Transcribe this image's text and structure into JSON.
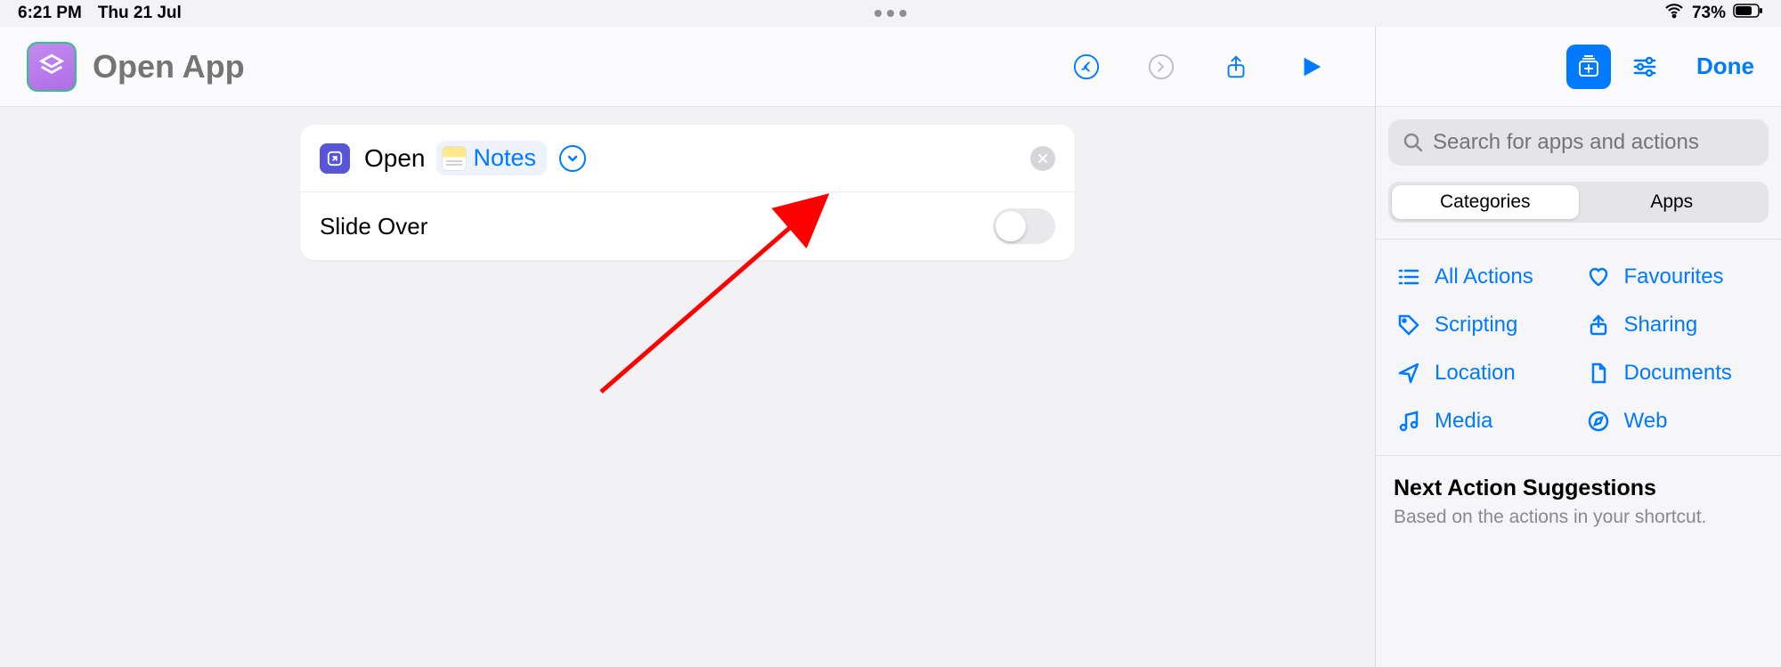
{
  "status": {
    "time": "6:21 PM",
    "date": "Thu 21 Jul",
    "battery_pct": "73%"
  },
  "header": {
    "title_placeholder": "Open App"
  },
  "action": {
    "verb": "Open",
    "app_label": "Notes",
    "slide_over_label": "Slide Over",
    "slide_over_on": false
  },
  "right": {
    "done": "Done",
    "search_placeholder": "Search for apps and actions",
    "segments": {
      "categories": "Categories",
      "apps": "Apps",
      "selected": "categories"
    },
    "categories": [
      {
        "key": "all",
        "icon": "list",
        "label": "All Actions"
      },
      {
        "key": "favourites",
        "icon": "heart",
        "label": "Favourites"
      },
      {
        "key": "scripting",
        "icon": "tag",
        "label": "Scripting"
      },
      {
        "key": "sharing",
        "icon": "share",
        "label": "Sharing"
      },
      {
        "key": "location",
        "icon": "location",
        "label": "Location"
      },
      {
        "key": "documents",
        "icon": "document",
        "label": "Documents"
      },
      {
        "key": "media",
        "icon": "music",
        "label": "Media"
      },
      {
        "key": "web",
        "icon": "compass",
        "label": "Web"
      }
    ],
    "suggestions": {
      "title": "Next Action Suggestions",
      "subtitle": "Based on the actions in your shortcut."
    }
  }
}
